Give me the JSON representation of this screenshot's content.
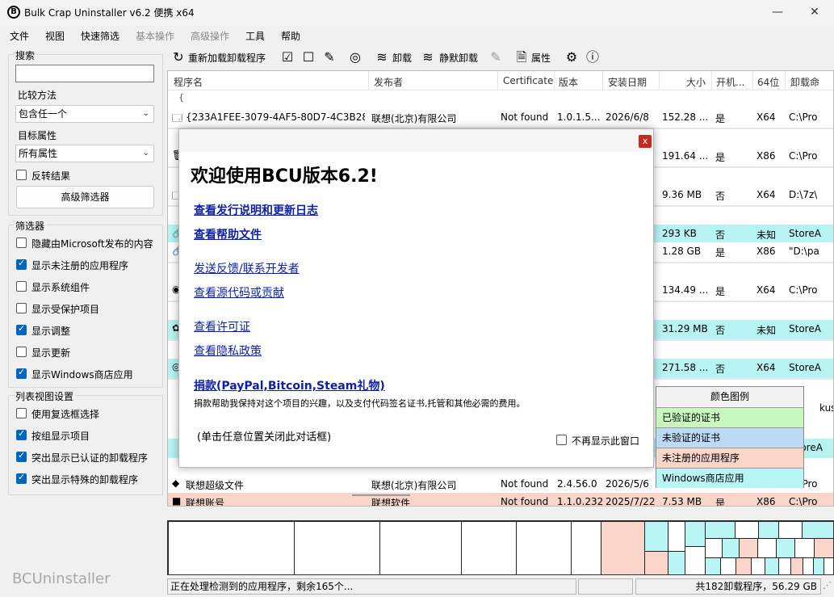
{
  "window": {
    "title": "Bulk Crap Uninstaller v6.2 便携 x64",
    "icon_letter": "B",
    "controls": [
      "—",
      "☐",
      "✕"
    ]
  },
  "menu": [
    "文件",
    "视图",
    "快速筛选",
    "基本操作",
    "高级操作",
    "工具",
    "帮助"
  ],
  "menu_disabled": [
    false,
    false,
    false,
    true,
    true,
    false,
    false
  ],
  "left": {
    "search_label": "搜索",
    "search_value": "",
    "compare_label": "比较方法",
    "compare_value": "包含任一个",
    "target_label": "目标属性",
    "target_value": "所有属性",
    "invert_label": "反转结果",
    "advanced_filter_button": "高级筛选器",
    "filters_label": "筛选器",
    "filters": [
      {
        "label": "隐藏由Microsoft发布的内容",
        "checked": false
      },
      {
        "label": "显示未注册的应用程序",
        "checked": true
      },
      {
        "label": "显示系统组件",
        "checked": false
      },
      {
        "label": "显示受保护项目",
        "checked": false
      },
      {
        "label": "显示调整",
        "checked": true
      },
      {
        "label": "显示更新",
        "checked": false
      },
      {
        "label": "显示Windows商店应用",
        "checked": true
      }
    ],
    "listview_label": "列表视图设置",
    "listview": [
      {
        "label": "使用复选框选择",
        "checked": false
      },
      {
        "label": "按组显示项目",
        "checked": true
      },
      {
        "label": "突出显示已认证的卸载程序",
        "checked": true
      },
      {
        "label": "突出显示特殊的卸载程序",
        "checked": true
      }
    ],
    "watermark": "BCUninstaller"
  },
  "toolbar": {
    "reload": "重新加载卸载程序",
    "uninstall": "卸载",
    "quiet_uninstall": "静默卸载",
    "properties": "属性"
  },
  "columns": [
    "程序名",
    "发布者",
    "Certificate",
    "版本",
    "安装日期",
    "大小",
    "开机...",
    "64位",
    "卸载命"
  ],
  "rows": [
    {
      "name": "{233A1FEE-3079-4AF5-80D7-4C3B28...",
      "publisher": "联想(北京)有限公司",
      "cert": "Not found",
      "version": "1.0.1.5...",
      "date": "2026/6/8",
      "size": "152.28 ...",
      "startup": "是",
      "x64": "X64",
      "cmd": "C:\\Pro",
      "bg": "#ffffff",
      "icon": "🗔"
    },
    {
      "name": "",
      "publisher": "",
      "cert": "",
      "version": "",
      "date": "",
      "size": "191.64 ...",
      "startup": "是",
      "x64": "X86",
      "cmd": "C:\\Pro",
      "bg": "#ffffff",
      "icon": "🗑"
    },
    {
      "name": "",
      "publisher": "",
      "cert": "",
      "version": "",
      "date": "",
      "size": "9.36 MB",
      "startup": "否",
      "x64": "X64",
      "cmd": "D:\\7z\\",
      "bg": "#ffffff",
      "icon": "🗔"
    },
    {
      "name": "",
      "publisher": "",
      "cert": "",
      "version": "",
      "date": "",
      "size": "293 KB",
      "startup": "否",
      "x64": "未知",
      "cmd": "StoreA",
      "bg": "#b7f3f3",
      "icon": "🔗"
    },
    {
      "name": "",
      "publisher": "",
      "cert": "",
      "version": "",
      "date": "",
      "size": "1.28 GB",
      "startup": "是",
      "x64": "X86",
      "cmd": "\"D:\\pa",
      "bg": "#ffffff",
      "icon": "🔗"
    },
    {
      "name": "",
      "publisher": "",
      "cert": "",
      "version": "",
      "date": "",
      "size": "134.49 ...",
      "startup": "是",
      "x64": "X64",
      "cmd": "C:\\Pro",
      "bg": "#ffffff",
      "icon": "◉"
    },
    {
      "name": "",
      "publisher": "",
      "cert": "",
      "version": "",
      "date": "",
      "size": "31.29 MB",
      "startup": "否",
      "x64": "未知",
      "cmd": "StoreA",
      "bg": "#b7f3f3",
      "icon": "✿"
    },
    {
      "name": "",
      "publisher": "",
      "cert": "",
      "version": "",
      "date": "",
      "size": "271.58 ...",
      "startup": "否",
      "x64": "X64",
      "cmd": "StoreA",
      "bg": "#b7f3f3",
      "icon": "◎"
    },
    {
      "name": "联想超级文件",
      "publisher": "联想(北京)有限公司",
      "cert": "Not found",
      "version": "2.4.56.0",
      "date": "2026/5/6",
      "size": "",
      "startup": "",
      "x64": "",
      "cmd": "C:\\Pro",
      "bg": "#ffffff",
      "icon": "◆"
    },
    {
      "name": "联想账号",
      "publisher": "联想软件",
      "cert": "Not found",
      "version": "1.1.0.232",
      "date": "2025/7/22",
      "size": "7.53 MB",
      "startup": "是",
      "x64": "X86",
      "cmd": "C:\\Pro",
      "bg": "#f8d5c8",
      "icon": "■"
    }
  ],
  "partial_right_cells": [
    "kus",
    "StoreA"
  ],
  "dialog": {
    "close": "x",
    "title": "欢迎使用BCU版本6.2!",
    "links": [
      "查看发行说明和更新日志",
      "查看帮助文件",
      "发送反馈/联系开发者",
      "查看源代码或贡献",
      "查看许可证",
      "查看隐私政策"
    ],
    "donate": "捐款(PayPal,Bitcoin,Steam礼物)",
    "donate_desc": "捐款帮助我保持对这个项目的兴趣，以及支付代码签名证书,托管和其他必需的费用。",
    "hint": "(单击任意位置关闭此对话框)",
    "dont_show": "不再显示此窗口"
  },
  "legend": {
    "title": "颜色图例",
    "items": [
      {
        "label": "已验证的证书",
        "color": "#c8f7c0"
      },
      {
        "label": "未验证的证书",
        "color": "#bcd9f5"
      },
      {
        "label": "未注册的应用程序",
        "color": "#f9d6c9"
      },
      {
        "label": "Windows商店应用",
        "color": "#b9f5f5"
      }
    ]
  },
  "status": {
    "left": "正在处理检测到的应用程序，剩余165个...",
    "right": "共182卸载程序，56.29 GB"
  }
}
